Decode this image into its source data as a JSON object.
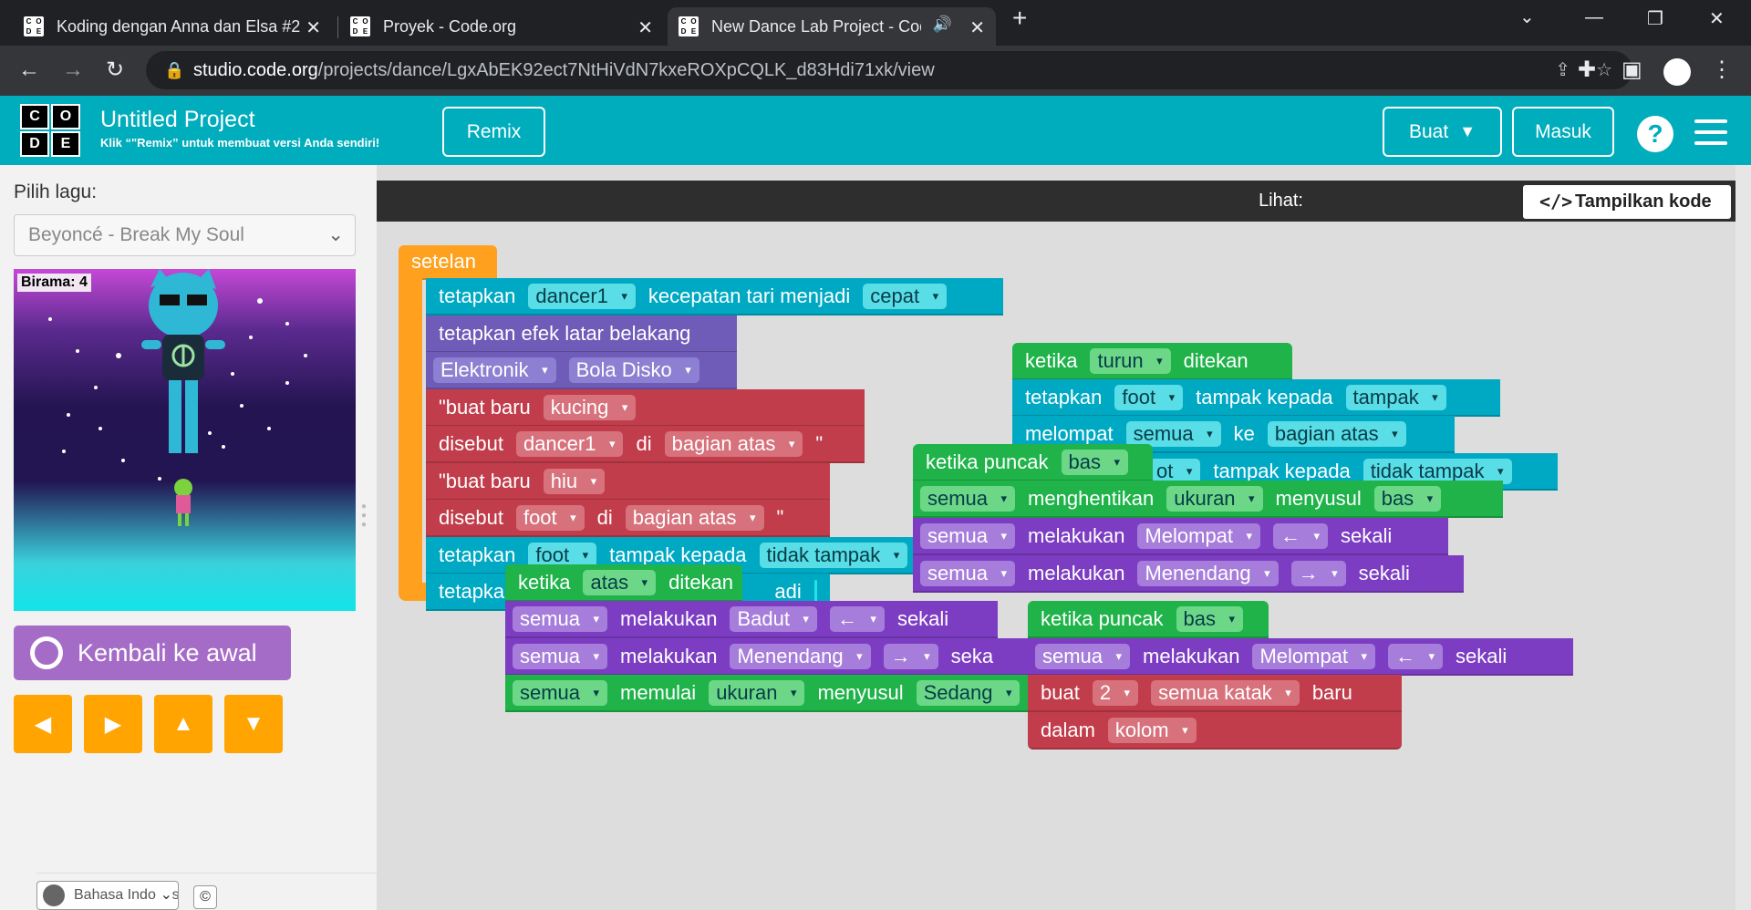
{
  "browser": {
    "tabs": [
      {
        "title": "Koding dengan Anna dan Elsa #2"
      },
      {
        "title": "Proyek - Code.org"
      },
      {
        "title": "New Dance Lab Project - Code.org"
      }
    ],
    "new_tab": "+",
    "url_host": "studio.code.org",
    "url_path": "/projects/dance/LgxAbEK92ect7NtHiVdN7kxeROXpCQLK_d83Hdi71xk/view"
  },
  "header": {
    "logo": [
      "C",
      "O",
      "D",
      "E"
    ],
    "title": "Untitled Project",
    "subtitle": "Klik “\"Remix” untuk membuat versi Anda sendiri!",
    "remix": "Remix",
    "buat": "Buat",
    "masuk": "Masuk",
    "help": "?"
  },
  "left": {
    "song_label": "Pilih lagu:",
    "song_value": "Beyoncé - Break My Soul",
    "measure": "Birama: 4",
    "reset": "Kembali ke awal",
    "arrows": [
      "◀",
      "▶",
      "▲",
      "▼"
    ],
    "language": "Bahasa Indonesia",
    "copyright": "©"
  },
  "workspace": {
    "header": "Lihat:",
    "show_code": "Tampilkan kode",
    "show_code_icon": "</>",
    "blocks": {
      "setup": "setelan",
      "b1": [
        "tetapkan",
        "dancer1",
        "kecepatan tari menjadi",
        "cepat"
      ],
      "b2": [
        "tetapkan efek latar belakang"
      ],
      "b3": [
        "Elektronik",
        "Bola Disko"
      ],
      "b4": [
        "\"buat baru",
        "kucing"
      ],
      "b5": [
        "disebut",
        "dancer1",
        "di",
        "bagian atas",
        "\""
      ],
      "b6": [
        "\"buat baru",
        "hiu"
      ],
      "b7": [
        "disebut",
        "foot",
        "di",
        "bagian atas",
        "\""
      ],
      "b8": [
        "tetapkan",
        "foot",
        "tampak kepada",
        "tidak tampak"
      ],
      "b9": [
        "tetapkan",
        "adi"
      ],
      "t1": [
        "ketika",
        "turun",
        "ditekan"
      ],
      "t1a": [
        "tetapkan",
        "foot",
        "tampak kepada",
        "tampak"
      ],
      "t1b": [
        "melompat",
        "semua",
        "ke",
        "bagian atas"
      ],
      "t1c": [
        "ot",
        "tampak kepada",
        "tidak tampak"
      ],
      "t2": [
        "ketika puncak",
        "bas"
      ],
      "t2a": [
        "semua",
        "menghentikan",
        "ukuran",
        "menyusul",
        "bas"
      ],
      "t2b": [
        "semua",
        "melakukan",
        "Melompat",
        "←",
        "sekali"
      ],
      "t2c": [
        "semua",
        "melakukan",
        "Menendang",
        "→",
        "sekali"
      ],
      "t3": [
        "ketika",
        "atas",
        "ditekan"
      ],
      "t3a": [
        "semua",
        "melakukan",
        "Badut",
        "←",
        "sekali"
      ],
      "t3b": [
        "semua",
        "melakukan",
        "Menendang",
        "→",
        "seka"
      ],
      "t3c": [
        "semua",
        "memulai",
        "ukuran",
        "menyusul",
        "Sedang"
      ],
      "t4": [
        "ketika puncak",
        "bas"
      ],
      "t4a": [
        "semua",
        "melakukan",
        "Melompat",
        "←",
        "sekali"
      ],
      "t4b": [
        "buat",
        "2",
        "semua katak",
        "baru"
      ],
      "t4c": [
        "dalam",
        "kolom"
      ]
    }
  },
  "colors": {
    "header": "#00adbc",
    "setup": "#ffa11f",
    "cyan_block": "#00a9c3",
    "purple_block": "#6e5cb8",
    "red_block": "#c13d4b",
    "green_block": "#1fb34a",
    "violet_block": "#7c3dc3"
  }
}
